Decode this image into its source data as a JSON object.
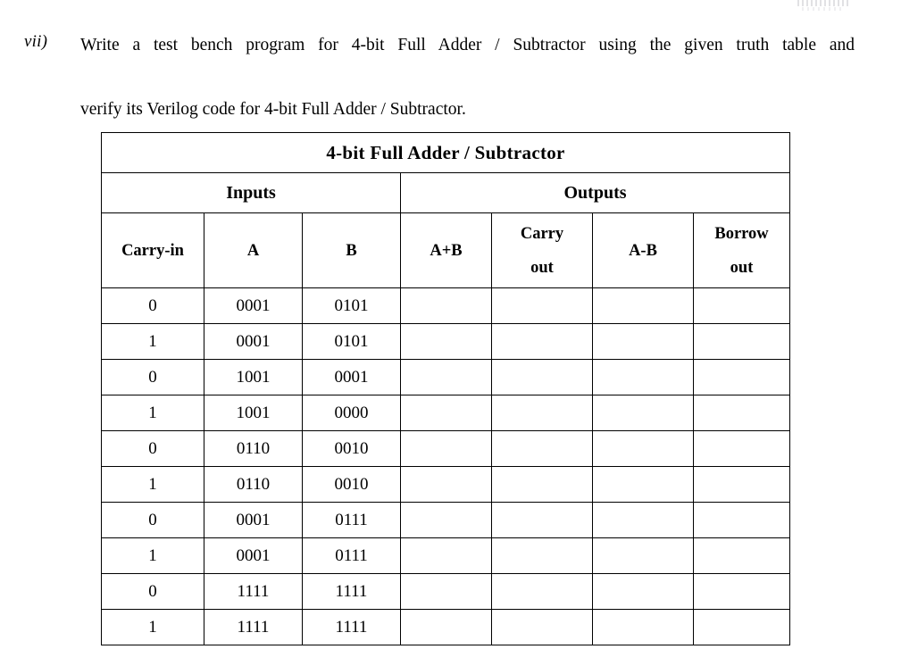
{
  "question": {
    "marker": "vii)",
    "line1": "Write a test bench program for 4-bit Full Adder / Subtractor using the given truth table and",
    "line2": "verify its Verilog code for 4-bit Full Adder / Subtractor."
  },
  "table": {
    "title": "4-bit Full Adder  / Subtractor",
    "groups": [
      {
        "label": "Inputs",
        "span": 3
      },
      {
        "label": "Outputs",
        "span": 4
      }
    ],
    "columns": [
      {
        "label": "Carry-in",
        "label2": ""
      },
      {
        "label": "A",
        "label2": ""
      },
      {
        "label": "B",
        "label2": ""
      },
      {
        "label": "A+B",
        "label2": ""
      },
      {
        "label": "Carry",
        "label2": "out"
      },
      {
        "label": "A-B",
        "label2": ""
      },
      {
        "label": "Borrow",
        "label2": "out"
      }
    ],
    "rows": [
      {
        "carry_in": "0",
        "a": "0001",
        "b": "0101",
        "a_plus_b": "",
        "carry_out": "",
        "a_minus_b": "",
        "borrow_out": ""
      },
      {
        "carry_in": "1",
        "a": "0001",
        "b": "0101",
        "a_plus_b": "",
        "carry_out": "",
        "a_minus_b": "",
        "borrow_out": ""
      },
      {
        "carry_in": "0",
        "a": "1001",
        "b": "0001",
        "a_plus_b": "",
        "carry_out": "",
        "a_minus_b": "",
        "borrow_out": ""
      },
      {
        "carry_in": "1",
        "a": "1001",
        "b": "0000",
        "a_plus_b": "",
        "carry_out": "",
        "a_minus_b": "",
        "borrow_out": ""
      },
      {
        "carry_in": "0",
        "a": "0110",
        "b": "0010",
        "a_plus_b": "",
        "carry_out": "",
        "a_minus_b": "",
        "borrow_out": ""
      },
      {
        "carry_in": "1",
        "a": "0110",
        "b": "0010",
        "a_plus_b": "",
        "carry_out": "",
        "a_minus_b": "",
        "borrow_out": ""
      },
      {
        "carry_in": "0",
        "a": "0001",
        "b": "0111",
        "a_plus_b": "",
        "carry_out": "",
        "a_minus_b": "",
        "borrow_out": ""
      },
      {
        "carry_in": "1",
        "a": "0001",
        "b": "0111",
        "a_plus_b": "",
        "carry_out": "",
        "a_minus_b": "",
        "borrow_out": ""
      },
      {
        "carry_in": "0",
        "a": "1111",
        "b": "1111",
        "a_plus_b": "",
        "carry_out": "",
        "a_minus_b": "",
        "borrow_out": ""
      },
      {
        "carry_in": "1",
        "a": "1111",
        "b": "1111",
        "a_plus_b": "",
        "carry_out": "",
        "a_minus_b": "",
        "borrow_out": ""
      }
    ]
  },
  "colors": {
    "page_background": "#ffffff",
    "text": "#000000",
    "table_border": "#000000"
  }
}
